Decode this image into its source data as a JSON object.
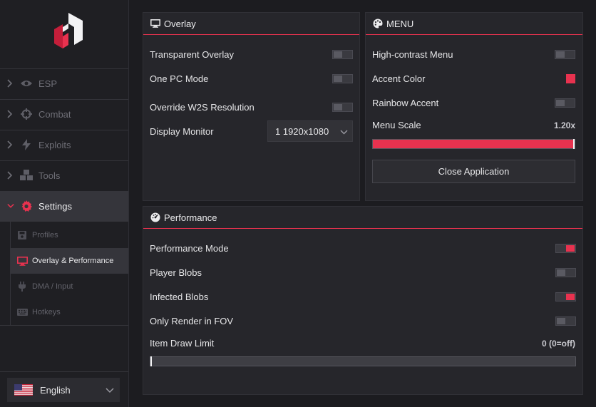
{
  "sidebar": {
    "nav": [
      {
        "label": "ESP",
        "icon": "eye-icon"
      },
      {
        "label": "Combat",
        "icon": "crosshair-icon"
      },
      {
        "label": "Exploits",
        "icon": "bolt-icon"
      },
      {
        "label": "Tools",
        "icon": "cubes-icon"
      },
      {
        "label": "Settings",
        "icon": "gear-icon"
      }
    ],
    "sub": [
      {
        "label": "Profiles",
        "icon": "save-icon"
      },
      {
        "label": "Overlay & Performance",
        "icon": "monitor-icon"
      },
      {
        "label": "DMA / Input",
        "icon": "plug-icon"
      },
      {
        "label": "Hotkeys",
        "icon": "keyboard-icon"
      }
    ],
    "language": "English"
  },
  "overlay": {
    "title": "Overlay",
    "transparent_overlay": {
      "label": "Transparent Overlay",
      "on": false
    },
    "one_pc_mode": {
      "label": "One PC Mode",
      "on": false
    },
    "override_w2s": {
      "label": "Override W2S Resolution",
      "on": false
    },
    "display_monitor": {
      "label": "Display Monitor",
      "value": "1  1920x1080"
    }
  },
  "menu": {
    "title": "MENU",
    "high_contrast": {
      "label": "High-contrast Menu",
      "on": false
    },
    "accent_color": {
      "label": "Accent Color",
      "value": "#e8324f"
    },
    "rainbow_accent": {
      "label": "Rainbow Accent",
      "on": false
    },
    "menu_scale": {
      "label": "Menu Scale",
      "value": "1.20x",
      "fraction": 1.0
    },
    "close_button": "Close Application"
  },
  "performance": {
    "title": "Performance",
    "performance_mode": {
      "label": "Performance Mode",
      "on": true
    },
    "player_blobs": {
      "label": "Player Blobs",
      "on": false
    },
    "infected_blobs": {
      "label": "Infected Blobs",
      "on": true
    },
    "only_render_fov": {
      "label": "Only Render in FOV",
      "on": false
    },
    "item_draw_limit": {
      "label": "Item Draw Limit",
      "value": "0 (0=off)",
      "fraction": 0.0
    }
  },
  "colors": {
    "accent": "#e8324f",
    "background": "#1c1c20",
    "panel": "#26262b"
  }
}
